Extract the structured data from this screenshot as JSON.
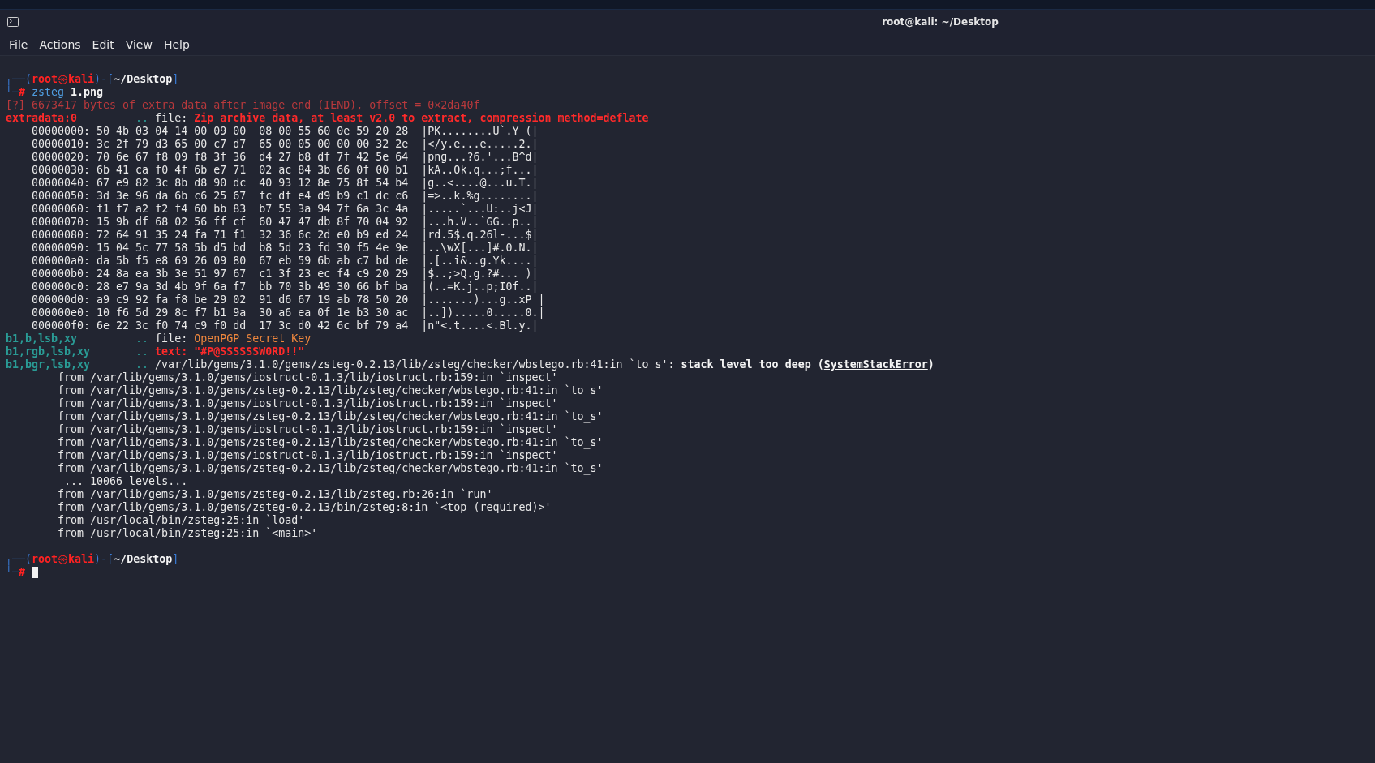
{
  "window": {
    "title": "root@kali: ~/Desktop"
  },
  "menu": [
    {
      "label": "File"
    },
    {
      "label": "Actions"
    },
    {
      "label": "Edit"
    },
    {
      "label": "View"
    },
    {
      "label": "Help"
    }
  ],
  "terminal": [
    {
      "kind": "prompt",
      "frame_top": "┌──(",
      "user": "root",
      "at": "㉿",
      "host": "kali",
      "mid": ")-[",
      "path": "~/Desktop",
      "end": "]",
      "frame_bottom": "└─",
      "symbol": "#",
      "command": "zsteg",
      "argument": "1.png",
      "cursor": false
    },
    {
      "kind": "warning",
      "text": "[?] 6673417 bytes of extra data after image end (IEND), offset = 0×2da40f"
    },
    {
      "kind": "result",
      "name": {
        "text": "extradata:0",
        "color": "#ff2a2a"
      },
      "dots": "..",
      "key": {
        "text": "file:",
        "color": "#e8e8e8"
      },
      "value": {
        "text": "Zip archive data, at least v2.0 to extract, compression method=deflate",
        "color": "#ff2a2a"
      }
    },
    {
      "kind": "hex",
      "offset": "00000000:",
      "bytes": "50 4b 03 04 14 00 09 00  08 00 55 60 0e 59 20 28",
      "ascii": "|PK........U`.Y (|"
    },
    {
      "kind": "hex",
      "offset": "00000010:",
      "bytes": "3c 2f 79 d3 65 00 c7 d7  65 00 05 00 00 00 32 2e",
      "ascii": "|</y.e...e.....2.|"
    },
    {
      "kind": "hex",
      "offset": "00000020:",
      "bytes": "70 6e 67 f8 09 f8 3f 36  d4 27 b8 df 7f 42 5e 64",
      "ascii": "|png...?6.'...B^d|"
    },
    {
      "kind": "hex",
      "offset": "00000030:",
      "bytes": "6b 41 ca f0 4f 6b e7 71  02 ac 84 3b 66 0f 00 b1",
      "ascii": "|kA..Ok.q...;f...|"
    },
    {
      "kind": "hex",
      "offset": "00000040:",
      "bytes": "67 e9 82 3c 8b d8 90 dc  40 93 12 8e 75 8f 54 b4",
      "ascii": "|g..<....@...u.T.|"
    },
    {
      "kind": "hex",
      "offset": "00000050:",
      "bytes": "3d 3e 96 da 6b c6 25 67  fc df e4 d9 b9 c1 dc c6",
      "ascii": "|=>..k.%g........|"
    },
    {
      "kind": "hex",
      "offset": "00000060:",
      "bytes": "f1 f7 a2 f2 f4 60 bb 83  b7 55 3a 94 7f 6a 3c 4a",
      "ascii": "|.....`...U:..j<J|"
    },
    {
      "kind": "hex",
      "offset": "00000070:",
      "bytes": "15 9b df 68 02 56 ff cf  60 47 47 db 8f 70 04 92",
      "ascii": "|...h.V..`GG..p..|"
    },
    {
      "kind": "hex",
      "offset": "00000080:",
      "bytes": "72 64 91 35 24 fa 71 f1  32 36 6c 2d e0 b9 ed 24",
      "ascii": "|rd.5$.q.26l-...$|"
    },
    {
      "kind": "hex",
      "offset": "00000090:",
      "bytes": "15 04 5c 77 58 5b d5 bd  b8 5d 23 fd 30 f5 4e 9e",
      "ascii": "|..\\wX[...]#.0.N.|"
    },
    {
      "kind": "hex",
      "offset": "000000a0:",
      "bytes": "da 5b f5 e8 69 26 09 80  67 eb 59 6b ab c7 bd de",
      "ascii": "|.[..i&..g.Yk....|"
    },
    {
      "kind": "hex",
      "offset": "000000b0:",
      "bytes": "24 8a ea 3b 3e 51 97 67  c1 3f 23 ec f4 c9 20 29",
      "ascii": "|$..;>Q.g.?#... )|"
    },
    {
      "kind": "hex",
      "offset": "000000c0:",
      "bytes": "28 e7 9a 3d 4b 9f 6a f7  bb 70 3b 49 30 66 bf ba",
      "ascii": "|(..=K.j..p;I0f..|"
    },
    {
      "kind": "hex",
      "offset": "000000d0:",
      "bytes": "a9 c9 92 fa f8 be 29 02  91 d6 67 19 ab 78 50 20",
      "ascii": "|.......)...g..xP |"
    },
    {
      "kind": "hex",
      "offset": "000000e0:",
      "bytes": "10 f6 5d 29 8c f7 b1 9a  30 a6 ea 0f 1e b3 30 ac",
      "ascii": "|..]).....0.....0.|"
    },
    {
      "kind": "hex",
      "offset": "000000f0:",
      "bytes": "6e 22 3c f0 74 c9 f0 dd  17 3c d0 42 6c bf 79 a4",
      "ascii": "|n\"<.t....<.Bl.y.|"
    },
    {
      "kind": "result",
      "name": {
        "text": "b1,b,lsb,xy",
        "color": "#2a9b95"
      },
      "dots": "..",
      "key": {
        "text": "file:",
        "color": "#e8e8e8"
      },
      "value": {
        "text": "OpenPGP Secret Key",
        "color": "#f0883e"
      }
    },
    {
      "kind": "result",
      "name": {
        "text": "b1,rgb,lsb,xy",
        "color": "#2a9b95"
      },
      "dots": "..",
      "key": {
        "text": "text:",
        "color": "#ff2a2a"
      },
      "value": {
        "text": "\"#P@SSSSSSW0RD!!\"",
        "color": "#ff2a2a"
      }
    },
    {
      "kind": "error",
      "name": "b1,bgr,lsb,xy",
      "dots": "..",
      "location": "/var/lib/gems/3.1.0/gems/zsteg-0.2.13/lib/zsteg/checker/wbstego.rb:41:in `to_s':",
      "message": "stack level too deep (",
      "error_class": "SystemStackError",
      "close": ")"
    },
    {
      "kind": "trace",
      "text": "from /var/lib/gems/3.1.0/gems/iostruct-0.1.3/lib/iostruct.rb:159:in `inspect'"
    },
    {
      "kind": "trace",
      "text": "from /var/lib/gems/3.1.0/gems/zsteg-0.2.13/lib/zsteg/checker/wbstego.rb:41:in `to_s'"
    },
    {
      "kind": "trace",
      "text": "from /var/lib/gems/3.1.0/gems/iostruct-0.1.3/lib/iostruct.rb:159:in `inspect'"
    },
    {
      "kind": "trace",
      "text": "from /var/lib/gems/3.1.0/gems/zsteg-0.2.13/lib/zsteg/checker/wbstego.rb:41:in `to_s'"
    },
    {
      "kind": "trace",
      "text": "from /var/lib/gems/3.1.0/gems/iostruct-0.1.3/lib/iostruct.rb:159:in `inspect'"
    },
    {
      "kind": "trace",
      "text": "from /var/lib/gems/3.1.0/gems/zsteg-0.2.13/lib/zsteg/checker/wbstego.rb:41:in `to_s'"
    },
    {
      "kind": "trace",
      "text": "from /var/lib/gems/3.1.0/gems/iostruct-0.1.3/lib/iostruct.rb:159:in `inspect'"
    },
    {
      "kind": "trace",
      "text": "from /var/lib/gems/3.1.0/gems/zsteg-0.2.13/lib/zsteg/checker/wbstego.rb:41:in `to_s'"
    },
    {
      "kind": "skipped",
      "text": "... 10066 levels..."
    },
    {
      "kind": "trace",
      "text": "from /var/lib/gems/3.1.0/gems/zsteg-0.2.13/lib/zsteg.rb:26:in `run'"
    },
    {
      "kind": "trace",
      "text": "from /var/lib/gems/3.1.0/gems/zsteg-0.2.13/bin/zsteg:8:in `<top (required)>'"
    },
    {
      "kind": "trace",
      "text": "from /usr/local/bin/zsteg:25:in `load'"
    },
    {
      "kind": "trace",
      "text": "from /usr/local/bin/zsteg:25:in `<main>'"
    },
    {
      "kind": "blank"
    },
    {
      "kind": "prompt",
      "frame_top": "┌──(",
      "user": "root",
      "at": "㉿",
      "host": "kali",
      "mid": ")-[",
      "path": "~/Desktop",
      "end": "]",
      "frame_bottom": "└─",
      "symbol": "#",
      "cursor": true
    }
  ]
}
